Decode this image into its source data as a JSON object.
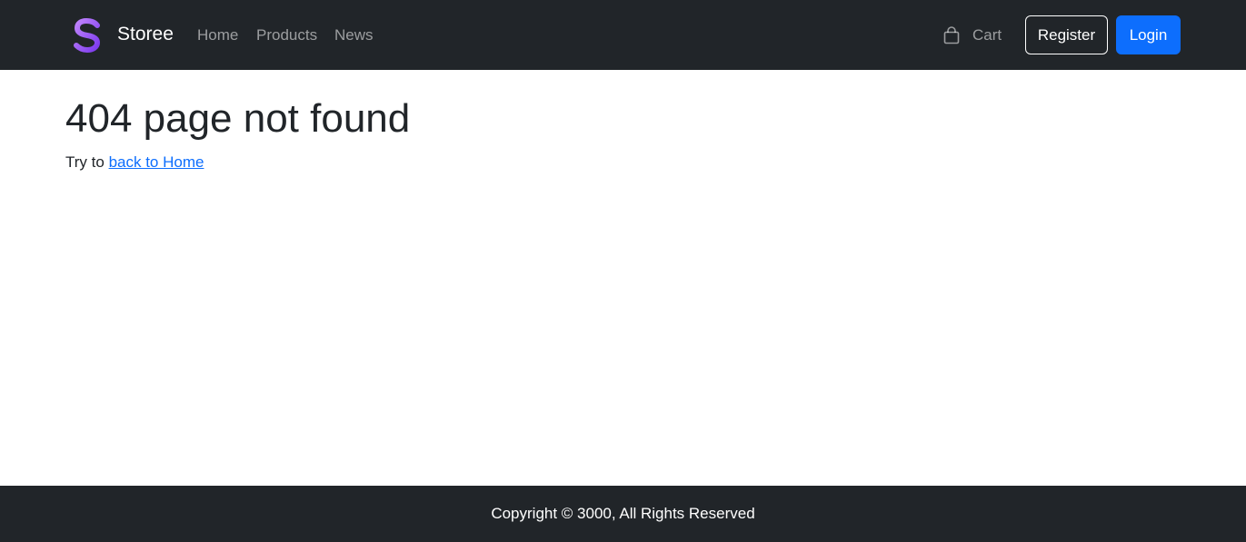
{
  "navbar": {
    "brand": "Storee",
    "logo_colors": {
      "top": "#a855f7",
      "bottom": "#6d28d9"
    },
    "links": [
      "Home",
      "Products",
      "News"
    ],
    "cart_label": "Cart",
    "cart_icon": "shopping-bag-icon",
    "register_label": "Register",
    "login_label": "Login"
  },
  "main": {
    "title": "404 page not found",
    "prefix": "Try to",
    "link_text": "back to Home"
  },
  "footer": {
    "copyright": "Copyright © 3000, All Rights Reserved"
  },
  "colors": {
    "navbar_bg": "#212529",
    "primary": "#0d6efd",
    "text": "#212529"
  }
}
